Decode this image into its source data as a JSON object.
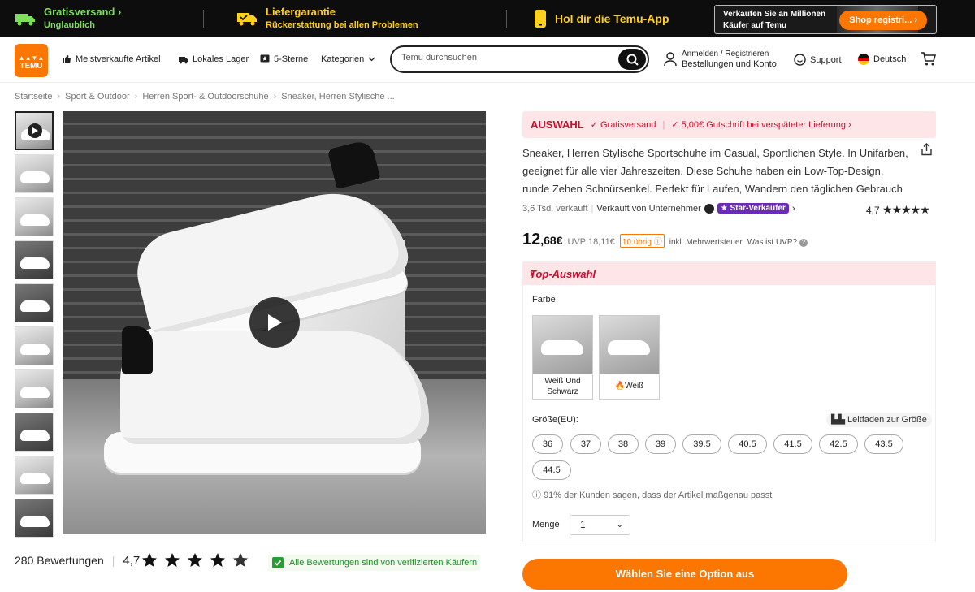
{
  "promo": {
    "shipping_title": "Gratisversand",
    "shipping_sub": "Unglaublich",
    "guarantee_title": "Liefergarantie",
    "guarantee_sub": "Rückerstattung bei allen Problemen",
    "app_text": "Hol dir die Temu-App",
    "sell_text": "Verkaufen Sie an Millionen Käufer auf Temu",
    "sell_button": "Shop registri..."
  },
  "header": {
    "logo_text": "TEMU",
    "nav": [
      "Meistverkaufte Artikel",
      "Lokales Lager",
      "5-Sterne",
      "Kategorien"
    ],
    "search_placeholder": "Temu durchsuchen",
    "account_line1": "Anmelden / Registrieren",
    "account_line2": "Bestellungen und Konto",
    "support": "Support",
    "language": "Deutsch"
  },
  "breadcrumb": [
    "Startseite",
    "Sport & Outdoor",
    "Herren Sport- & Outdoorschuhe",
    "Sneaker, Herren Stylische ..."
  ],
  "reviews": {
    "count_label": "280 Bewertungen",
    "rating": "4,7",
    "verified": "Alle Bewertungen sind von verifizierten Käufern"
  },
  "product": {
    "banner_auswahl": "AUSWAHL",
    "banner_free": "Gratisversand",
    "banner_credit": "5,00€ Gutschrift bei verspäteter Lieferung",
    "title": "Sneaker, Herren Stylische Sportschuhe im Casual, Sportlichen Style. In Unifarben, geeignet für alle vier Jahreszeiten. Diese Schuhe haben ein Low-Top-Design, runde Zehen Schnürsenkel. Perfekt für Laufen, Wandern den täglichen Gebrauch",
    "sold": "3,6 Tsd. verkauft",
    "seller": "Verkauft von Unternehmer",
    "star_seller": "Star-Verkäufer",
    "rating": "4,7",
    "price_main": "12",
    "price_cents": ",68€",
    "uvp": "UVP 18,11€",
    "left": "10 übrig",
    "incl": "inkl. Mehrwertsteuer",
    "uvp_question": "Was ist UVP?"
  },
  "options": {
    "top_label": "Top-Auswahl",
    "color_label": "Farbe",
    "colors": [
      "Weiß Und Schwarz",
      "Weiß"
    ],
    "size_label": "Größe(EU):",
    "size_guide": "Leitfaden zur Größe",
    "sizes": [
      "36",
      "37",
      "38",
      "39",
      "39.5",
      "40.5",
      "41.5",
      "42.5",
      "43.5",
      "44.5"
    ],
    "fit_note": "91% der Kunden sagen, dass der Artikel maßgenau passt",
    "qty_label": "Menge",
    "qty_value": "1",
    "cta": "Wählen Sie eine Option aus"
  },
  "colors": {
    "accent": "#fb7701",
    "sale_red": "#c8102e",
    "promo_green": "#7ee05a",
    "promo_yellow": "#ffd11a"
  }
}
